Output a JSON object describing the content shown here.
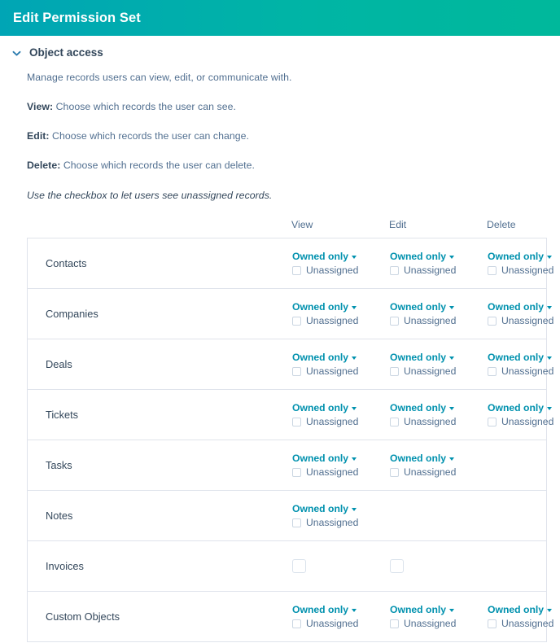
{
  "header": {
    "title": "Edit Permission Set",
    "gradient_from": "#00a5b5",
    "gradient_to": "#00b89b"
  },
  "section": {
    "toggle_icon": "chevron-down-icon",
    "title": "Object access",
    "lede": "Manage records users can view, edit, or communicate with.",
    "definitions": [
      {
        "term": "View:",
        "desc": " Choose which records the user can see."
      },
      {
        "term": "Edit:",
        "desc": " Choose which records the user can change."
      },
      {
        "term": "Delete:",
        "desc": " Choose which records the user can delete."
      }
    ],
    "note": "Use the checkbox to let users see unassigned records."
  },
  "table": {
    "columns": [
      "View",
      "Edit",
      "Delete"
    ],
    "dropdown_label": "Owned only",
    "checkbox_label": "Unassigned",
    "accent_color": "#0091ae",
    "rows": [
      {
        "name": "Contacts",
        "cells": [
          {
            "type": "dropdown"
          },
          {
            "type": "dropdown"
          },
          {
            "type": "dropdown"
          }
        ]
      },
      {
        "name": "Companies",
        "cells": [
          {
            "type": "dropdown"
          },
          {
            "type": "dropdown"
          },
          {
            "type": "dropdown"
          }
        ]
      },
      {
        "name": "Deals",
        "cells": [
          {
            "type": "dropdown"
          },
          {
            "type": "dropdown"
          },
          {
            "type": "dropdown"
          }
        ]
      },
      {
        "name": "Tickets",
        "cells": [
          {
            "type": "dropdown"
          },
          {
            "type": "dropdown"
          },
          {
            "type": "dropdown"
          }
        ]
      },
      {
        "name": "Tasks",
        "cells": [
          {
            "type": "dropdown"
          },
          {
            "type": "dropdown"
          },
          {
            "type": "none"
          }
        ]
      },
      {
        "name": "Notes",
        "cells": [
          {
            "type": "dropdown"
          },
          {
            "type": "none"
          },
          {
            "type": "none"
          }
        ]
      },
      {
        "name": "Invoices",
        "cells": [
          {
            "type": "checkbox"
          },
          {
            "type": "checkbox"
          },
          {
            "type": "none"
          }
        ]
      },
      {
        "name": "Custom Objects",
        "cells": [
          {
            "type": "dropdown"
          },
          {
            "type": "dropdown"
          },
          {
            "type": "dropdown"
          }
        ]
      }
    ]
  }
}
